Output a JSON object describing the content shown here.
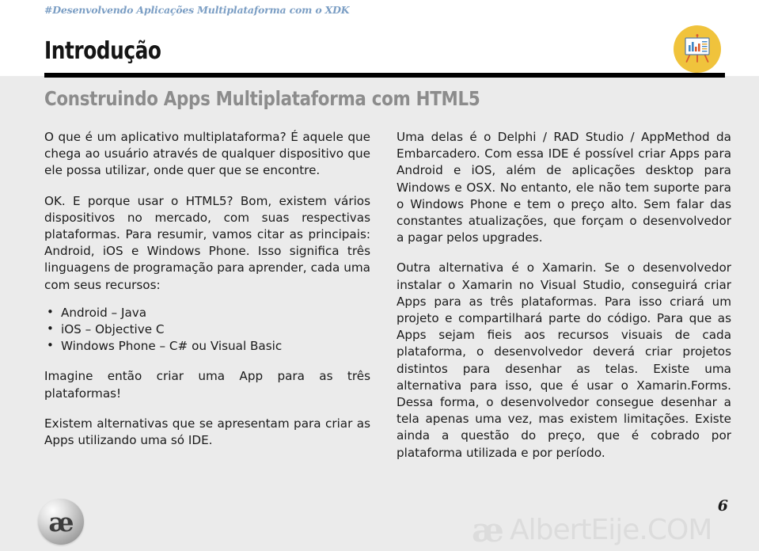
{
  "header": {
    "kicker": "#Desenvolvendo Aplicações Multiplataforma com o XDK",
    "title": "Introdução",
    "logo_icon": "presentation-chart-icon",
    "rule_color": "#000000",
    "band_color": "#ffffff",
    "logo_disc_color": "#f0c33c"
  },
  "subtitle": "Construindo Apps Multiplataforma com HTML5",
  "body": {
    "left_column": {
      "paragraphs": [
        "O que é um aplicativo multiplataforma? É aquele que chega ao usuário através de qualquer dispositivo que ele possa utilizar, onde quer que se encontre.",
        "OK. E porque usar o HTML5? Bom, existem vários dispositivos no mercado, com suas respectivas plataformas. Para resumir, vamos citar as principais: Android, iOS e Windows Phone. Isso significa três linguagens de programação para aprender, cada uma com seus recursos:"
      ],
      "bullet_marker": "•",
      "bullets": [
        "Android – Java",
        "iOS – Objective C",
        "Windows Phone – C# ou Visual Basic"
      ],
      "paragraphs_after": [
        "Imagine então criar uma App para as três plataformas!",
        "Existem alternativas que se apresentam para criar as Apps utilizando uma só IDE."
      ]
    },
    "right_column": {
      "paragraphs": [
        "Uma delas é o Delphi / RAD Studio / AppMethod da Embarcadero. Com essa IDE é possível criar Apps para Android e iOS, além de aplicações desktop para Windows e OSX. No entanto, ele não tem suporte para o Windows Phone e tem o preço alto. Sem falar das constantes atualizações, que forçam o desenvolvedor a pagar pelos upgrades.",
        "Outra alternativa é o Xamarin. Se o desenvolvedor instalar o Xamarin no Visual Studio, conseguirá criar Apps para as três plataformas. Para isso criará um projeto e compartilhará parte do código. Para que as Apps sejam fieis aos recursos visuais de cada plataforma, o desenvolvedor deverá criar projetos distintos para desenhar as telas. Existe uma alternativa para isso, que é usar o Xamarin.Forms. Dessa forma, o desenvolvedor consegue desenhar a tela apenas uma vez, mas existem limitações. Existe ainda a questão do preço, que é cobrado por plataforma utilizada e por período."
      ]
    }
  },
  "footer": {
    "logo_glyph": "æ",
    "logo_icon": "ae-monogram-icon",
    "page_number": "6",
    "watermark_mark": "æ",
    "watermark_text": "AlbertEije.COM"
  }
}
